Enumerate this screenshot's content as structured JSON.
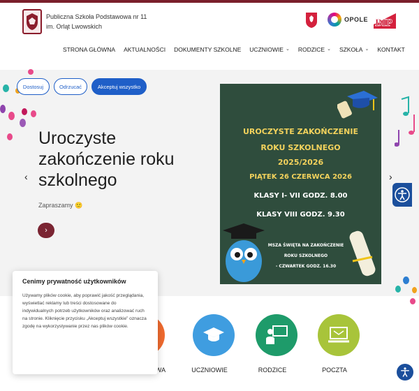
{
  "header": {
    "school_line1": "Publiczna Szkoła Podstawowa nr 11",
    "school_line2": "im. Orląt Lwowskich",
    "opole_text": "OPOLE",
    "bip_text": "BIP"
  },
  "nav": {
    "items": [
      {
        "label": "STRONA GŁÓWNA"
      },
      {
        "label": "AKTUALNOŚCI"
      },
      {
        "label": "DOKUMENTY SZKOLNE"
      },
      {
        "label": "UCZNIOWIE",
        "dropdown": true
      },
      {
        "label": "RODZICE",
        "dropdown": true
      },
      {
        "label": "SZKOŁA",
        "dropdown": true
      },
      {
        "label": "KONTAKT"
      }
    ],
    "chevron": "⌄"
  },
  "hero": {
    "title": "Uroczyste zakończenie roku szkolnego",
    "subtitle": "Zapraszamy 🙂",
    "button_glyph": "›",
    "prev_glyph": "‹",
    "next_glyph": "›"
  },
  "poster": {
    "line1": "UROCZYSTE ZAKOŃCZENIE",
    "line2": "ROKU SZKOLNEGO",
    "line3": "2025/2026",
    "line4": "PIĄTEK 26 CZERWCA 2026",
    "line5": "KLASY I- VII  GODZ. 8.00",
    "line6": "KLASY VIII GODZ. 9.30",
    "line7": "MSZA ŚWIĘTA NA ZAKOŃCZENIE",
    "line8": "ROKU SZKOLNEGO",
    "line9": "- CZWARTEK  GODZ. 16.30"
  },
  "cards": [
    {
      "label": "WA",
      "color": "#ef6a2f",
      "icon": "partial-icon"
    },
    {
      "label": "UCZNIOWIE",
      "color": "#3f9de0",
      "icon": "graduation-cap-icon"
    },
    {
      "label": "RODZICE",
      "color": "#1e9b6a",
      "icon": "teacher-board-icon"
    },
    {
      "label": "POCZTA",
      "color": "#a8c43a",
      "icon": "laptop-mail-icon"
    }
  ],
  "cookie": {
    "title": "Cenimy prywatność użytkowników",
    "text": "Używamy plików cookie, aby poprawić jakość przeglądania, wyświetlać reklamy lub treści dostosowane do indywidualnych potrzeb użytkowników oraz analizować ruch na stronie. Kliknięcie przycisku „Akceptuj wszystkie” oznacza zgodę na wykorzystywanie przez nas plików cookie.",
    "btn_customize": "Dostosuj",
    "btn_reject": "Odrzucać",
    "btn_accept": "Akceptuj wszystko"
  },
  "colors": {
    "brand": "#7a1f2b",
    "accent_blue": "#1f5fc8",
    "poster_bg": "#2f4d3d",
    "poster_text": "#f3d25c"
  }
}
